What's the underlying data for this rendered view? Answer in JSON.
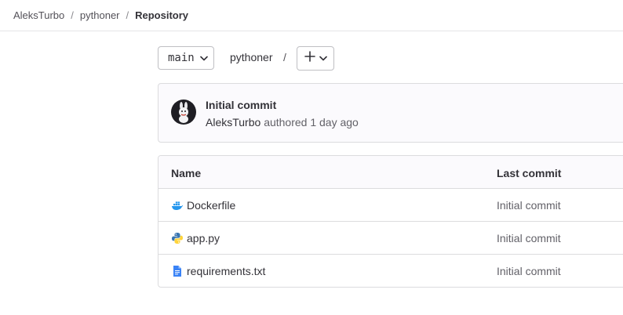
{
  "breadcrumb": {
    "user": "AleksTurbo",
    "project": "pythoner",
    "current": "Repository",
    "separator": "/"
  },
  "toolbar": {
    "branch": "main",
    "path": "pythoner",
    "path_separator": "/"
  },
  "commit": {
    "title": "Initial commit",
    "author": "AleksTurbo",
    "meta_suffix": "authored 1 day ago"
  },
  "table": {
    "headers": {
      "name": "Name",
      "last_commit": "Last commit"
    },
    "rows": [
      {
        "name": "Dockerfile",
        "icon": "docker-icon",
        "last_commit": "Initial commit"
      },
      {
        "name": "app.py",
        "icon": "python-icon",
        "last_commit": "Initial commit"
      },
      {
        "name": "requirements.txt",
        "icon": "text-file-icon",
        "last_commit": "Initial commit"
      }
    ]
  },
  "colors": {
    "text": "#333238",
    "border": "#dcdcde",
    "docker": "#2496ed",
    "python_blue": "#3a75b0",
    "python_yellow": "#ffd43b",
    "file_blue": "#3a83f6"
  }
}
